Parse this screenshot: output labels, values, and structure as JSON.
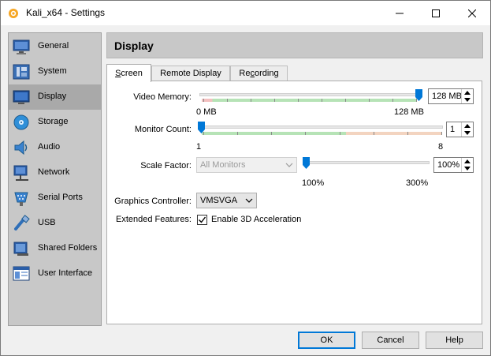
{
  "window": {
    "title": "Kali_x64 - Settings"
  },
  "sidebar": {
    "items": [
      {
        "label": "General",
        "icon": "monitor-icon"
      },
      {
        "label": "System",
        "icon": "chip-icon"
      },
      {
        "label": "Display",
        "icon": "display-icon",
        "active": true
      },
      {
        "label": "Storage",
        "icon": "disk-icon"
      },
      {
        "label": "Audio",
        "icon": "speaker-icon"
      },
      {
        "label": "Network",
        "icon": "network-icon"
      },
      {
        "label": "Serial Ports",
        "icon": "serial-icon"
      },
      {
        "label": "USB",
        "icon": "usb-icon"
      },
      {
        "label": "Shared Folders",
        "icon": "folder-icon"
      },
      {
        "label": "User Interface",
        "icon": "ui-icon"
      }
    ]
  },
  "header": {
    "title": "Display"
  },
  "tabs": [
    {
      "label": "Screen",
      "mnemonic": "S",
      "rest": "creen",
      "active": true
    },
    {
      "label": "Remote Display",
      "mnemonic": "",
      "rest": "Remote Display"
    },
    {
      "label": "Recording",
      "pre": "Re",
      "mnemonic": "c",
      "rest": "ording"
    }
  ],
  "screen": {
    "video_memory": {
      "label": "Video Memory:",
      "value": "128 MB",
      "min_label": "0 MB",
      "max_label": "128 MB",
      "level": 1.0
    },
    "monitor_count": {
      "label": "Monitor Count:",
      "value": "1",
      "min_label": "1",
      "max_label": "8",
      "level": 0.0
    },
    "scale_factor": {
      "label": "Scale Factor:",
      "monitor_select": "All Monitors",
      "value": "100%",
      "min_label": "100%",
      "max_label": "300%",
      "level": 0.0
    },
    "graphics_controller": {
      "label": "Graphics Controller:",
      "value": "VMSVGA"
    },
    "extended_features": {
      "label": "Extended Features:",
      "checkbox_label": "Enable 3D Acceleration",
      "checked": true
    }
  },
  "buttons": {
    "ok": "OK",
    "cancel": "Cancel",
    "help": "Help"
  },
  "colors": {
    "accent": "#0078d7",
    "active_item": "#a9a9a9",
    "sidebar": "#c8c8c8",
    "slider_green": "#b6e3b6",
    "slider_red": "#f3c0c0"
  }
}
